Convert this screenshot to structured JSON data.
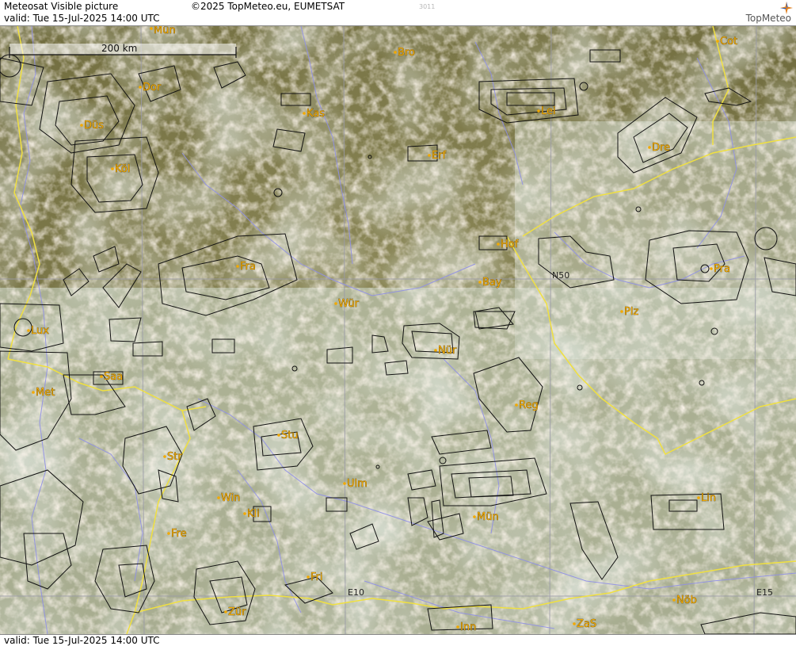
{
  "header": {
    "title": "Meteosat Visible picture",
    "copyright": "©2025 TopMeteo.eu, EUMETSAT",
    "valid": "valid:  Tue  15-Jul-2025  14:00 UTC",
    "code": "3011",
    "logo": "TopMeteo"
  },
  "footer": {
    "valid": "valid:  Tue  15-Jul-2025  14:00 UTC"
  },
  "map": {
    "scale_bar_label": "200 km",
    "grid_labels": {
      "n50": "N50",
      "e10": "E10",
      "e15": "E15"
    },
    "cities": [
      {
        "name": "Mün"
      },
      {
        "name": "Bro"
      },
      {
        "name": "Cot"
      },
      {
        "name": "Dor"
      },
      {
        "name": "Kas"
      },
      {
        "name": "Lei"
      },
      {
        "name": "Düs"
      },
      {
        "name": "Erf"
      },
      {
        "name": "Dre"
      },
      {
        "name": "Köl"
      },
      {
        "name": "Hof"
      },
      {
        "name": "Fra"
      },
      {
        "name": "Pra"
      },
      {
        "name": "Bay"
      },
      {
        "name": "Wür"
      },
      {
        "name": "Plz"
      },
      {
        "name": "Lux"
      },
      {
        "name": "Nür"
      },
      {
        "name": "Saa"
      },
      {
        "name": "Met"
      },
      {
        "name": "Reg"
      },
      {
        "name": "Stu"
      },
      {
        "name": "Str"
      },
      {
        "name": "Ulm"
      },
      {
        "name": "Win"
      },
      {
        "name": "Kli"
      },
      {
        "name": "Mün"
      },
      {
        "name": "Lin"
      },
      {
        "name": "Fre"
      },
      {
        "name": "Fri"
      },
      {
        "name": "Zür"
      },
      {
        "name": "Inn"
      },
      {
        "name": "ZaS"
      },
      {
        "name": "Nöb"
      }
    ],
    "colors": {
      "border": "#f0e040",
      "rivers": "#8f8fe8",
      "airspace": "#111111",
      "city_label": "#f2a900",
      "grid": "#9a9aa8"
    }
  }
}
